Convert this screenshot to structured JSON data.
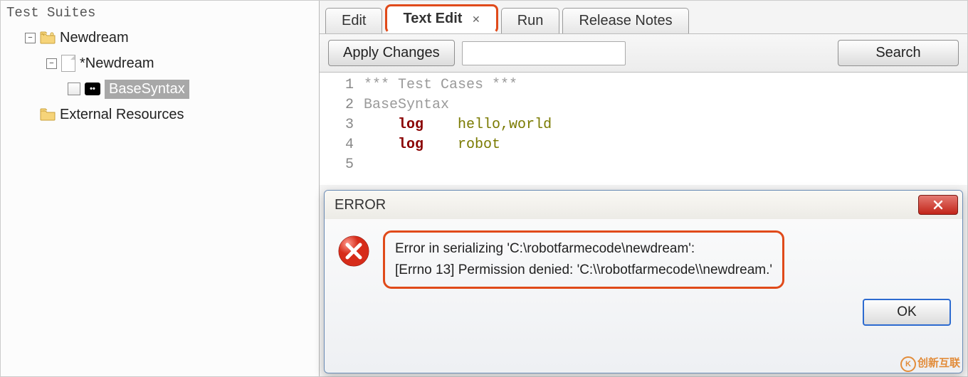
{
  "left": {
    "title": "Test Suites",
    "nodes": {
      "root": "Newdream",
      "suite": "*Newdream",
      "case": "BaseSyntax",
      "external": "External Resources"
    }
  },
  "tabs": {
    "edit": "Edit",
    "text_edit": "Text Edit",
    "run": "Run",
    "release": "Release Notes"
  },
  "toolbar": {
    "apply": "Apply Changes",
    "search": "Search",
    "search_value": ""
  },
  "editor": {
    "lines": {
      "l1_comment": "*** Test Cases ***",
      "l2": "BaseSyntax",
      "l3_kw": "log",
      "l3_arg": "hello,world",
      "l4_kw": "log",
      "l4_arg": "robot"
    }
  },
  "dialog": {
    "title": "ERROR",
    "line1": "Error in serializing 'C:\\robotfarmecode\\newdream':",
    "line2": "[Errno 13] Permission denied: 'C:\\\\robotfarmecode\\\\newdream.'",
    "ok": "OK"
  },
  "watermark": "创新互联"
}
